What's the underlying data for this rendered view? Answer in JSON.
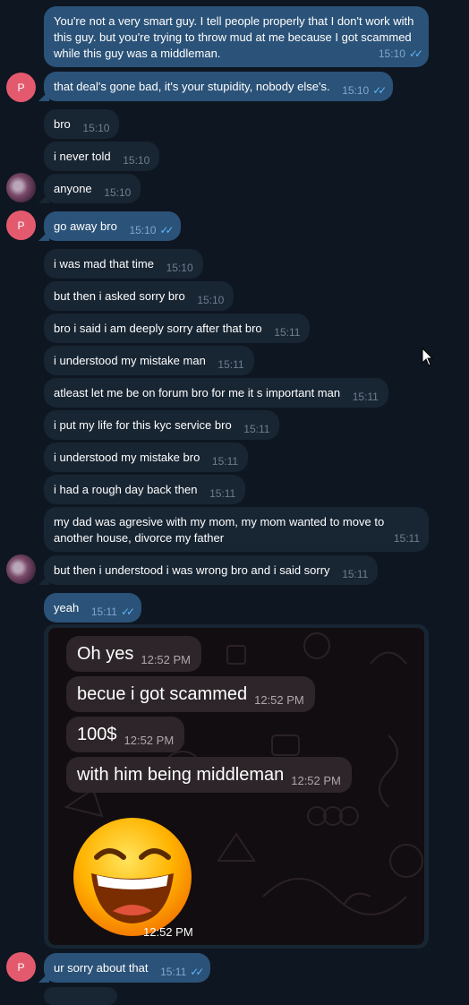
{
  "messages": [
    {
      "id": "m1",
      "text": "You're not a very smart guy. I tell people properly that I don't work with this guy. but you're trying to throw mud at me because I got scammed while this guy was a middleman.",
      "time": "15:10",
      "read": true
    },
    {
      "id": "m2",
      "text": "that deal's gone bad, it's your stupidity, nobody else's.",
      "time": "15:10",
      "read": true
    },
    {
      "id": "m3",
      "text": "bro",
      "time": "15:10"
    },
    {
      "id": "m4",
      "text": "i never told",
      "time": "15:10"
    },
    {
      "id": "m5",
      "text": "anyone",
      "time": "15:10"
    },
    {
      "id": "m6",
      "text": "go away bro",
      "time": "15:10",
      "read": true
    },
    {
      "id": "m7",
      "text": "i was mad that time",
      "time": "15:10"
    },
    {
      "id": "m8",
      "text": "but then i asked sorry bro",
      "time": "15:10"
    },
    {
      "id": "m9",
      "text": "bro i said i am deeply sorry after that bro",
      "time": "15:11"
    },
    {
      "id": "m10",
      "text": "i understood my mistake man",
      "time": "15:11"
    },
    {
      "id": "m11",
      "text": "atleast let me be on forum bro for me it s important man",
      "time": "15:11"
    },
    {
      "id": "m12",
      "text": "i put my life for this kyc service bro",
      "time": "15:11"
    },
    {
      "id": "m13",
      "text": "i understood my mistake bro",
      "time": "15:11"
    },
    {
      "id": "m14",
      "text": "i had a rough day back then",
      "time": "15:11"
    },
    {
      "id": "m15",
      "text": "my dad was agresive with my mom, my mom wanted to move to another house, divorce my father",
      "time": "15:11"
    },
    {
      "id": "m16",
      "text": "but then i understood i was wrong bro and i said sorry",
      "time": "15:11"
    },
    {
      "id": "m17",
      "text": "yeah",
      "time": "15:11",
      "read": true
    },
    {
      "id": "m18",
      "text": "ur sorry about that",
      "time": "15:11",
      "read": true
    }
  ],
  "avatars": {
    "p_letter": "P"
  },
  "screenshot": {
    "messages": [
      {
        "text": "Oh yes",
        "time": "12:52 PM"
      },
      {
        "text": "becue i got scammed",
        "time": "12:52 PM"
      },
      {
        "text": "100$",
        "time": "12:52 PM"
      },
      {
        "text": "with him being middleman",
        "time": "12:52 PM"
      }
    ],
    "emoji": "grinning-face-with-big-eyes-laughing",
    "emoji_time": "12:52 PM"
  },
  "ticks": "✓✓",
  "colors": {
    "background": "#0e1621",
    "incoming": "#182533",
    "outgoing": "#2b5278",
    "read_ticks": "#5eb5f7",
    "avatar_p": "#e35a6f"
  }
}
